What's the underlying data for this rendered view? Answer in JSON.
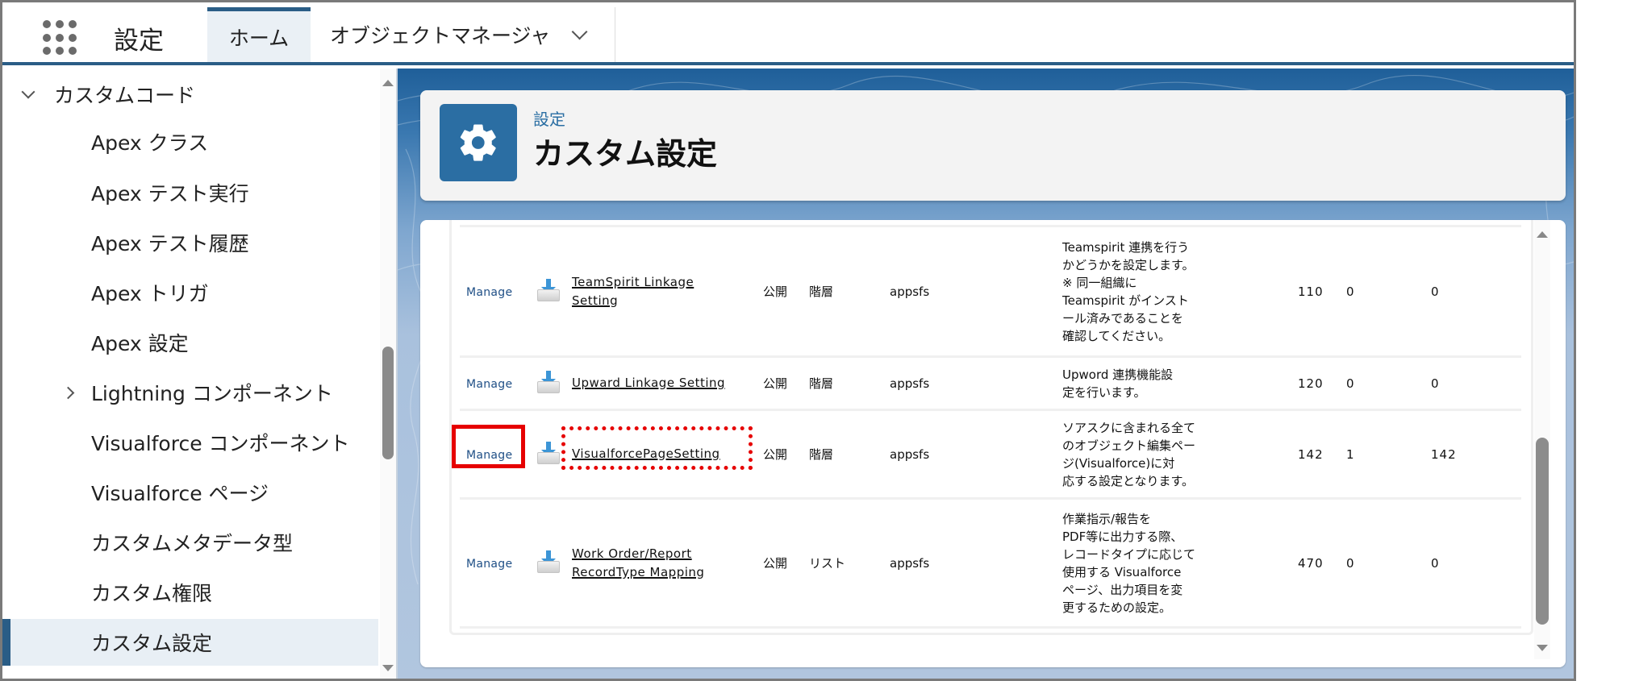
{
  "app": {
    "launcher_icon": "app-launcher-waffle-icon",
    "name": "設定"
  },
  "nav": {
    "tabs": [
      {
        "label": "ホーム",
        "active": true
      },
      {
        "label": "オブジェクトマネージャ",
        "has_dropdown": true
      }
    ]
  },
  "sidebar": {
    "group": {
      "label": "カスタムコード",
      "expanded": true
    },
    "items": [
      {
        "label": "Apex クラス"
      },
      {
        "label": "Apex テスト実行"
      },
      {
        "label": "Apex テスト履歴"
      },
      {
        "label": "Apex トリガ"
      },
      {
        "label": "Apex 設定"
      },
      {
        "label": "Lightning コンポーネント",
        "expandable": true
      },
      {
        "label": "Visualforce コンポーネント"
      },
      {
        "label": "Visualforce ページ"
      },
      {
        "label": "カスタムメタデータ型"
      },
      {
        "label": "カスタム権限"
      },
      {
        "label": "カスタム設定",
        "active": true
      }
    ]
  },
  "header": {
    "icon": "gear-icon",
    "breadcrumb": "設定",
    "title": "カスタム設定",
    "icon_color": "#2b6ea3"
  },
  "table": {
    "rows": [
      {
        "action": "Manage",
        "icon": "download-icon",
        "label_lines": [
          "TeamSpirit Linkage",
          "Setting"
        ],
        "visibility": "公開",
        "type": "階層",
        "namespace": "appsfs",
        "description_lines": [
          "Teamspirit 連携を行う",
          "かどうかを設定します。",
          "※ 同一組織に",
          "Teamspirit がインスト",
          "ール済みであることを",
          "確認してください。"
        ],
        "col1": "110",
        "col2": "0",
        "col3": "0"
      },
      {
        "action": "Manage",
        "icon": "download-icon",
        "label_lines": [
          "Upward Linkage Setting"
        ],
        "visibility": "公開",
        "type": "階層",
        "namespace": "appsfs",
        "description_lines": [
          "Upword 連携機能設",
          "定を行います。"
        ],
        "col1": "120",
        "col2": "0",
        "col3": "0"
      },
      {
        "action": "Manage",
        "icon": "download-icon",
        "label_lines": [
          "VisualforcePageSetting"
        ],
        "visibility": "公開",
        "type": "階層",
        "namespace": "appsfs",
        "description_lines": [
          "ソアスクに含まれる全て",
          "のオブジェクト編集ペー",
          "ジ(Visualforce)に対",
          "応する設定となります。"
        ],
        "col1": "142",
        "col2": "1",
        "col3": "142",
        "highlighted": true
      },
      {
        "action": "Manage",
        "icon": "download-icon",
        "label_lines": [
          "Work Order/Report",
          "RecordType Mapping"
        ],
        "visibility": "公開",
        "type": "リスト",
        "namespace": "appsfs",
        "description_lines": [
          "作業指示/報告を",
          "PDF等に出力する際、",
          "レコードタイプに応じて",
          "使用する Visualforce",
          "ページ、出力項目を変",
          "更するための設定。"
        ],
        "col1": "470",
        "col2": "0",
        "col3": "0"
      }
    ]
  },
  "annotations": {
    "solid_box_target": "Manage (VisualforcePageSetting row)",
    "dashed_box_target": "VisualforcePageSetting",
    "color": "#e60000"
  },
  "colors": {
    "brand": "#2a5d86",
    "link": "#1f4f86",
    "active_bg": "#e8eff5"
  }
}
